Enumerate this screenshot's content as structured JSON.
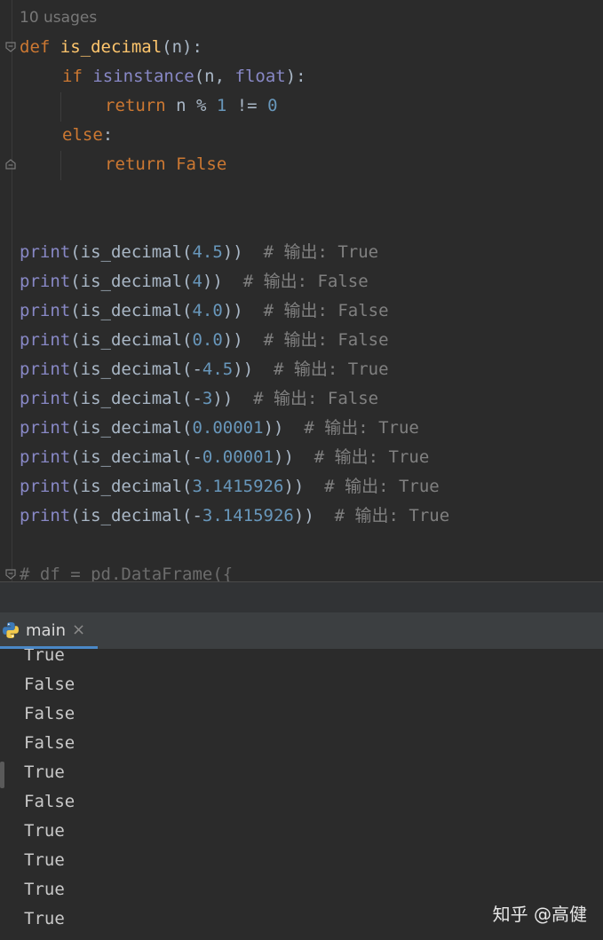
{
  "editor": {
    "usages": "10 usages",
    "func": {
      "def_kw": "def",
      "name": "is_decimal",
      "sig_open": "(n):",
      "if_kw": "if",
      "isinstance": "isinstance",
      "if_args_a": "(n, ",
      "float_kw": "float",
      "if_args_b": "):",
      "return_kw": "return",
      "mod_expr_a": " n % ",
      "one": "1",
      "neq": " != ",
      "zero": "0",
      "else_kw": "else",
      "colon": ":",
      "return_false_a": "return",
      "false_kw": " False"
    },
    "prints": [
      {
        "fn": "print",
        "open": "(is_decimal(",
        "arg": "4.5",
        "close": "))",
        "comment": "  # 输出: True"
      },
      {
        "fn": "print",
        "open": "(is_decimal(",
        "arg": "4",
        "close": "))",
        "comment": "  # 输出: False"
      },
      {
        "fn": "print",
        "open": "(is_decimal(",
        "arg": "4.0",
        "close": "))",
        "comment": "  # 输出: False"
      },
      {
        "fn": "print",
        "open": "(is_decimal(",
        "arg": "0.0",
        "close": "))",
        "comment": "  # 输出: False"
      },
      {
        "fn": "print",
        "open": "(is_decimal(-",
        "arg": "4.5",
        "close": "))",
        "comment": "  # 输出: True"
      },
      {
        "fn": "print",
        "open": "(is_decimal(-",
        "arg": "3",
        "close": "))",
        "comment": "  # 输出: False"
      },
      {
        "fn": "print",
        "open": "(is_decimal(",
        "arg": "0.00001",
        "close": "))",
        "comment": "  # 输出: True"
      },
      {
        "fn": "print",
        "open": "(is_decimal(-",
        "arg": "0.00001",
        "close": "))",
        "comment": "  # 输出: True"
      },
      {
        "fn": "print",
        "open": "(is_decimal(",
        "arg": "3.1415926",
        "close": "))",
        "comment": "  # 输出: True"
      },
      {
        "fn": "print",
        "open": "(is_decimal(-",
        "arg": "3.1415926",
        "close": "))",
        "comment": "  # 输出: True"
      }
    ],
    "trailing_comment": "# df = pd.DataFrame({"
  },
  "run_panel": {
    "tab_label": "main",
    "close_glyph": "×",
    "output": [
      "True",
      "False",
      "False",
      "False",
      "True",
      "False",
      "True",
      "True",
      "True",
      "True"
    ]
  },
  "watermark": "知乎 @高健"
}
